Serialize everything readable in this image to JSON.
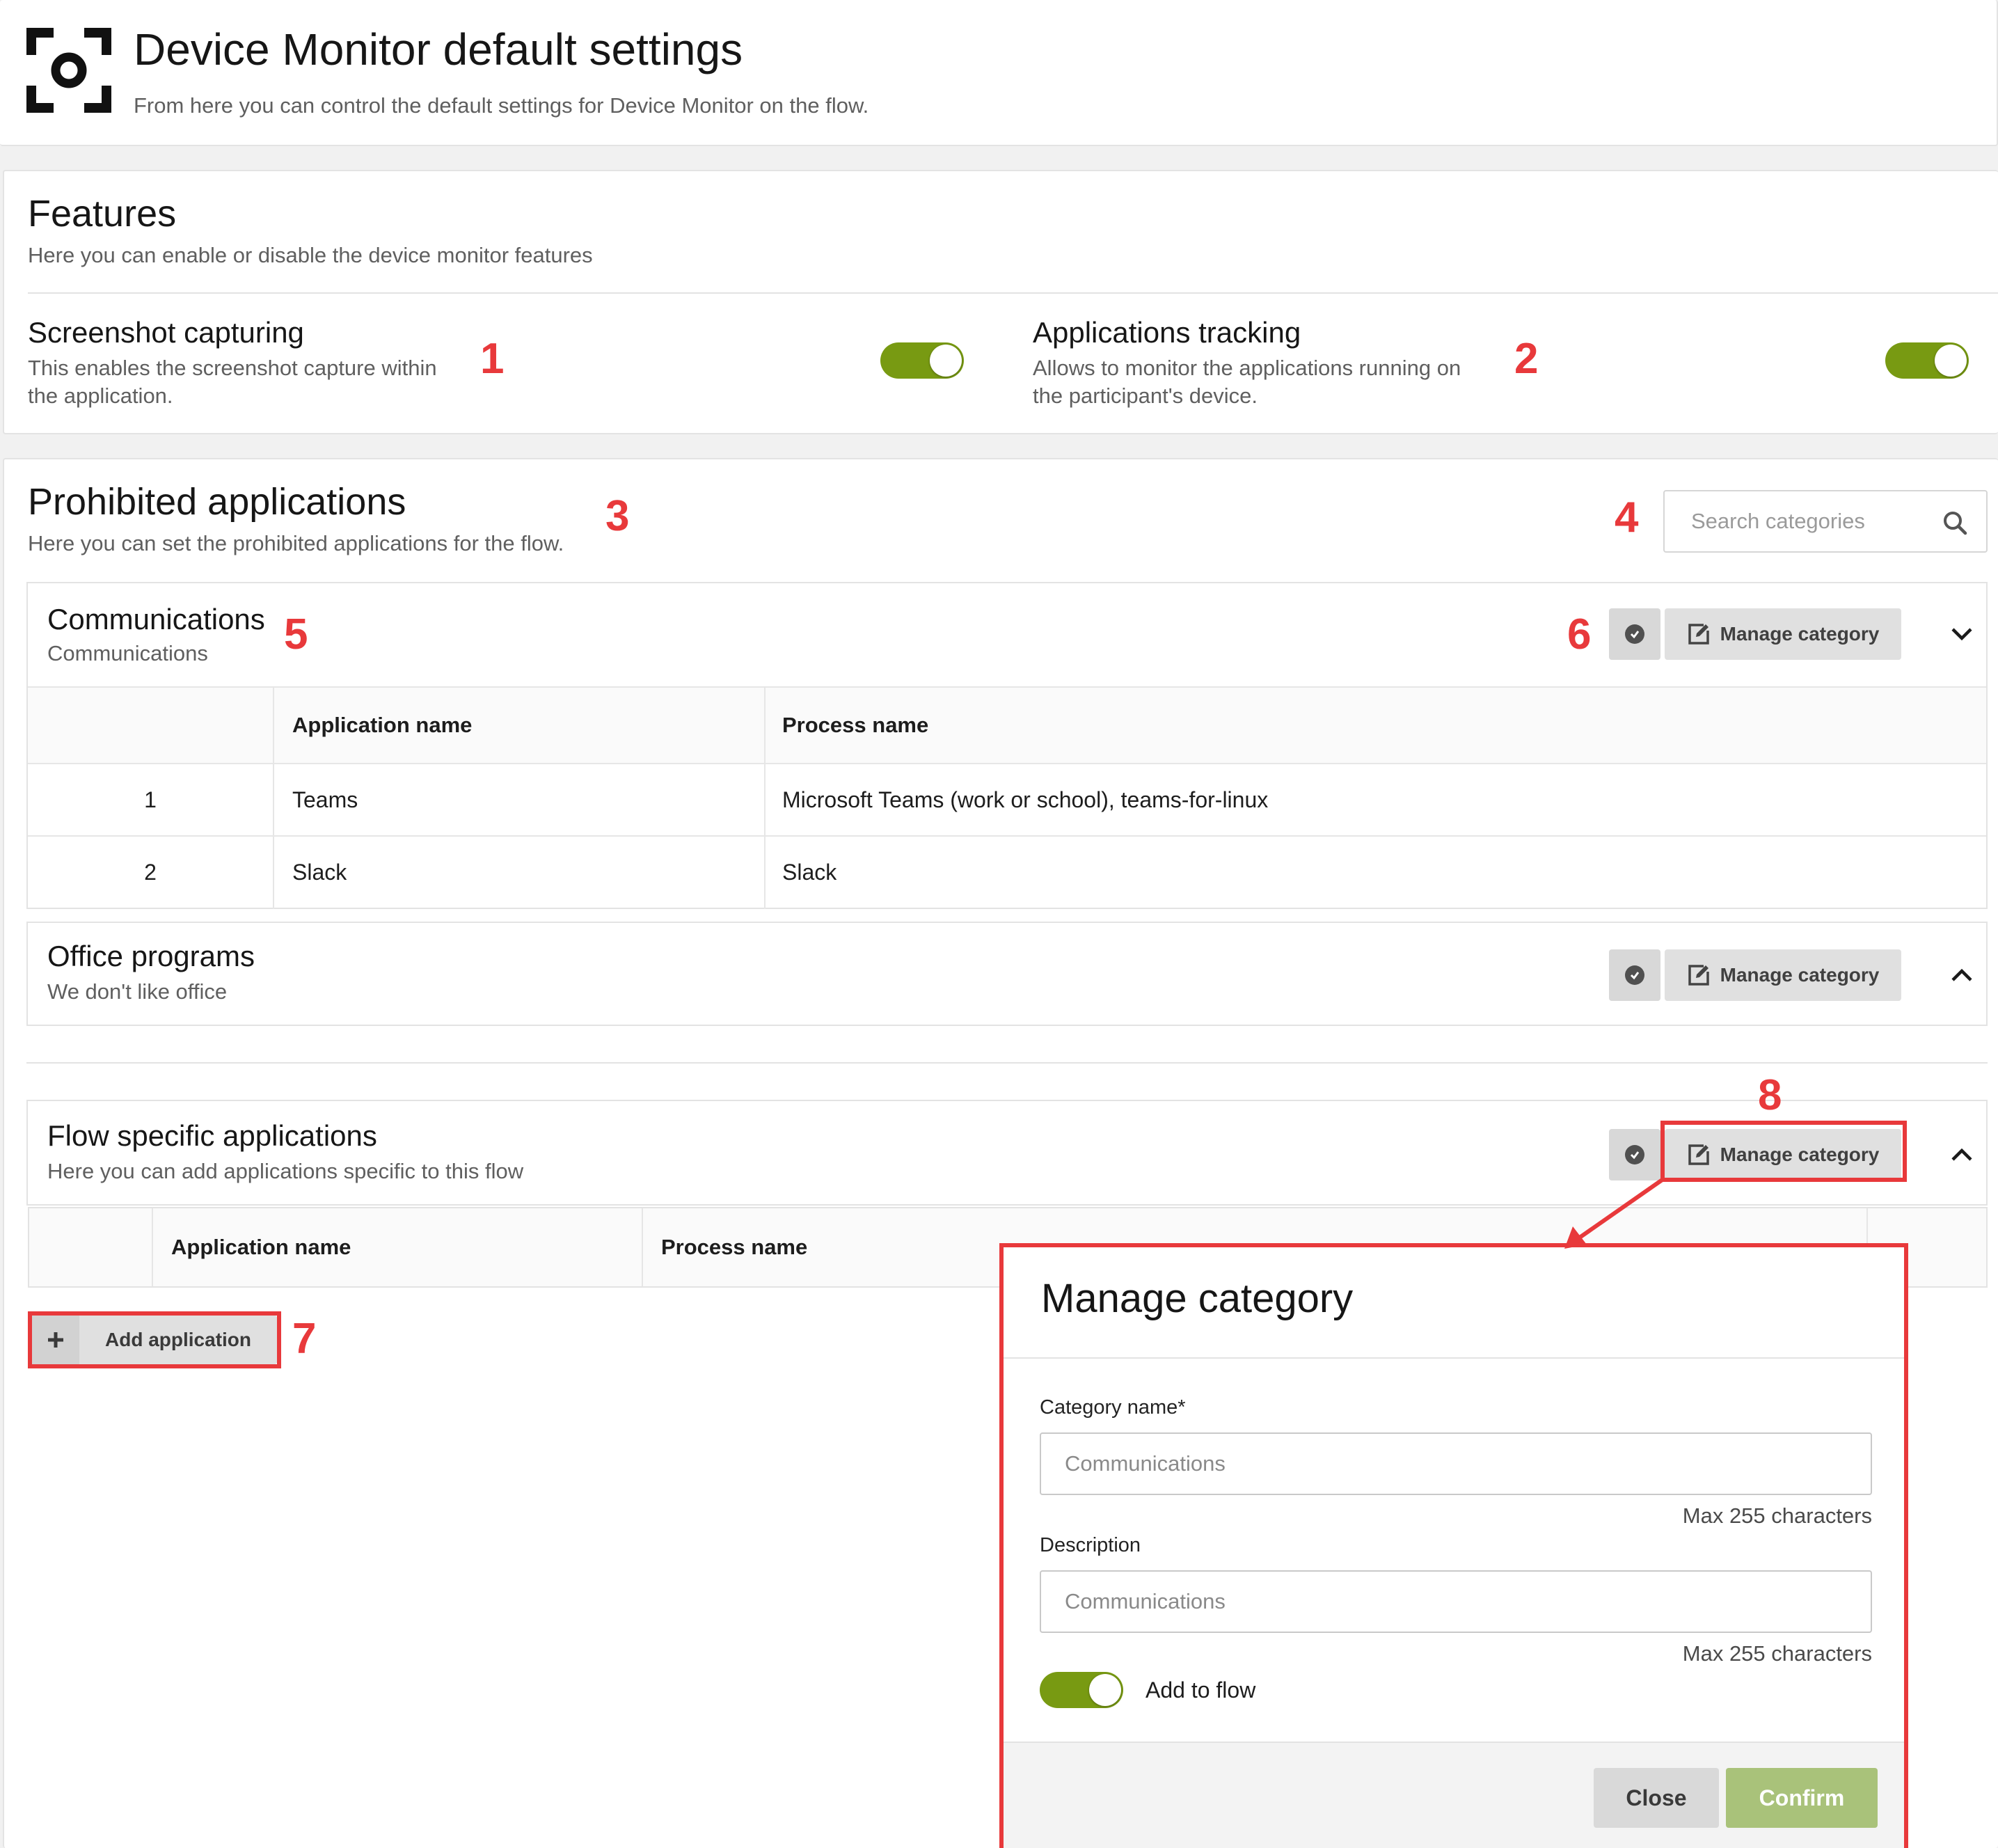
{
  "header": {
    "title": "Device Monitor default settings",
    "subtitle": "From here you can control the default settings for Device Monitor on the flow."
  },
  "features": {
    "title": "Features",
    "subtitle": "Here you can enable or disable the device monitor features",
    "screenshot": {
      "title": "Screenshot capturing",
      "desc_line1": "This enables the screenshot capture within",
      "desc_line2": "the application.",
      "enabled": true
    },
    "apps_tracking": {
      "title": "Applications tracking",
      "desc_line1": "Allows to monitor the applications running on",
      "desc_line2": "the participant's device.",
      "enabled": true
    }
  },
  "prohibited": {
    "title": "Prohibited applications",
    "subtitle": "Here you can set the prohibited applications for the flow.",
    "search_placeholder": "Search categories",
    "manage_label": "Manage category",
    "categories": [
      {
        "name": "Communications",
        "description": "Communications",
        "expanded": true,
        "columns": [
          "",
          "Application name",
          "Process name"
        ],
        "rows": [
          {
            "index": "1",
            "app": "Teams",
            "process": "Microsoft Teams (work or school), teams-for-linux"
          },
          {
            "index": "2",
            "app": "Slack",
            "process": "Slack"
          }
        ]
      },
      {
        "name": "Office programs",
        "description": "We don't like office",
        "expanded": false
      }
    ],
    "flow_specific": {
      "name": "Flow specific applications",
      "description": "Here you can add applications specific to this flow",
      "columns": [
        "",
        "Application name",
        "Process name"
      ],
      "add_label": "Add application"
    }
  },
  "modal": {
    "title": "Manage category",
    "name_label": "Category name*",
    "name_placeholder": "Communications",
    "name_hint": "Max 255 characters",
    "desc_label": "Description",
    "desc_placeholder": "Communications",
    "desc_hint": "Max 255 characters",
    "add_to_flow_label": "Add to flow",
    "add_to_flow": true,
    "close_label": "Close",
    "confirm_label": "Confirm"
  },
  "annotations": {
    "n1": "1",
    "n2": "2",
    "n3": "3",
    "n4": "4",
    "n5": "5",
    "n6": "6",
    "n7": "7",
    "n8": "8"
  },
  "colors": {
    "toggle_on": "#789a12",
    "annotation_red": "#e8393b",
    "confirm_bg": "#a9c27a"
  },
  "icons": [
    "device-monitor-icon",
    "search-icon",
    "check-circle-icon",
    "edit-icon",
    "chevron-down-icon",
    "chevron-up-icon",
    "plus-icon"
  ]
}
